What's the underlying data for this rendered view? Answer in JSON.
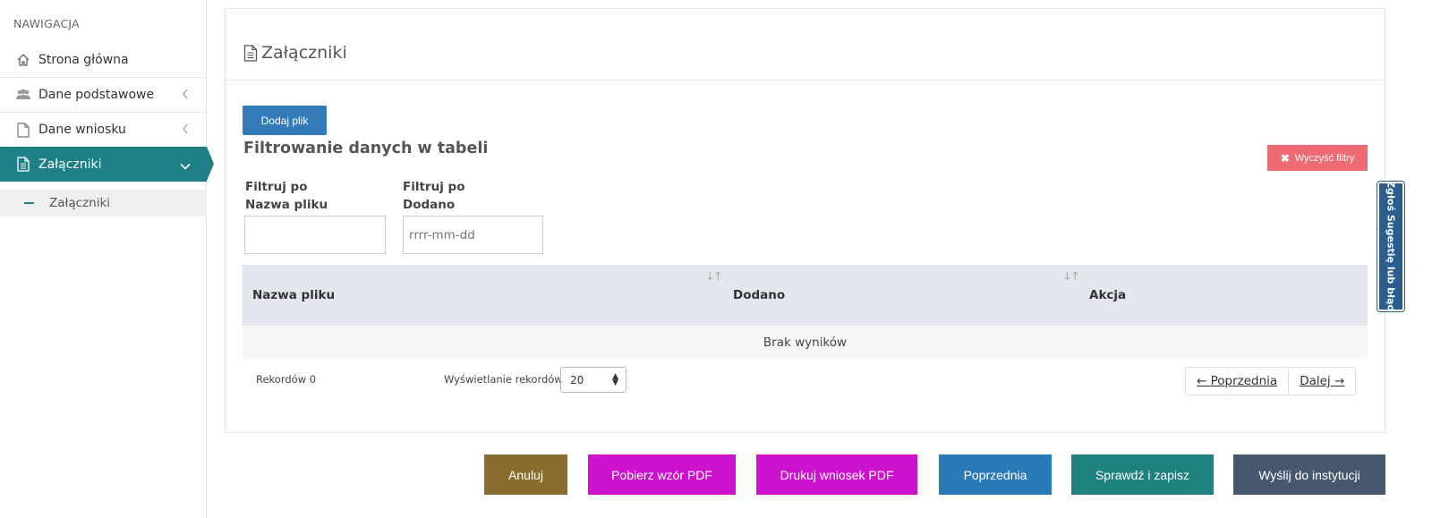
{
  "sidebar": {
    "header": "NAWIGACJA",
    "items": [
      {
        "label": "Strona główna",
        "icon": "home-icon"
      },
      {
        "label": "Dane podstawowe",
        "icon": "users-icon"
      },
      {
        "label": "Dane wniosku",
        "icon": "file-icon"
      },
      {
        "label": "Załączniki",
        "icon": "file-text-icon"
      }
    ],
    "subitems": [
      {
        "label": "Załączniki"
      }
    ]
  },
  "panel": {
    "title": "Załączniki",
    "add_button": "Dodaj plik",
    "filter_title": "Filtrowanie danych w tabeli",
    "clear_filters": "Wyczyść filtry",
    "filters": [
      {
        "label_line1": "Filtruj po",
        "label_line2": "Nazwa pliku",
        "value": "",
        "placeholder": ""
      },
      {
        "label_line1": "Filtruj po",
        "label_line2": "Dodano",
        "value": "",
        "placeholder": "rrrr-mm-dd"
      }
    ],
    "table": {
      "columns": [
        "Nazwa pliku",
        "Dodano",
        "Akcja"
      ],
      "empty_message": "Brak wyników"
    },
    "records_label": "Rekordów 0",
    "per_page_label": "Wyświetlanie rekordów",
    "per_page_value": "20",
    "pager": {
      "prev": "← Poprzednia",
      "next": "Dalej →"
    }
  },
  "side_tab": "Zgłoś Sugestię lub błąd",
  "footer_buttons": [
    {
      "label": "Anuluj",
      "color": "#8a6d2e"
    },
    {
      "label": "Pobierz wzór PDF",
      "color": "#cc12cc"
    },
    {
      "label": "Drukuj wniosek PDF",
      "color": "#cc12cc"
    },
    {
      "label": "Poprzednia",
      "color": "#2a7ab8"
    },
    {
      "label": "Sprawdź i zapisz",
      "color": "#1f8080"
    },
    {
      "label": "Wyślij do instytucji",
      "color": "#46586e"
    }
  ],
  "colors": {
    "accent": "#1f7f86",
    "primary": "#337ab7",
    "danger": "#ee6b73"
  }
}
